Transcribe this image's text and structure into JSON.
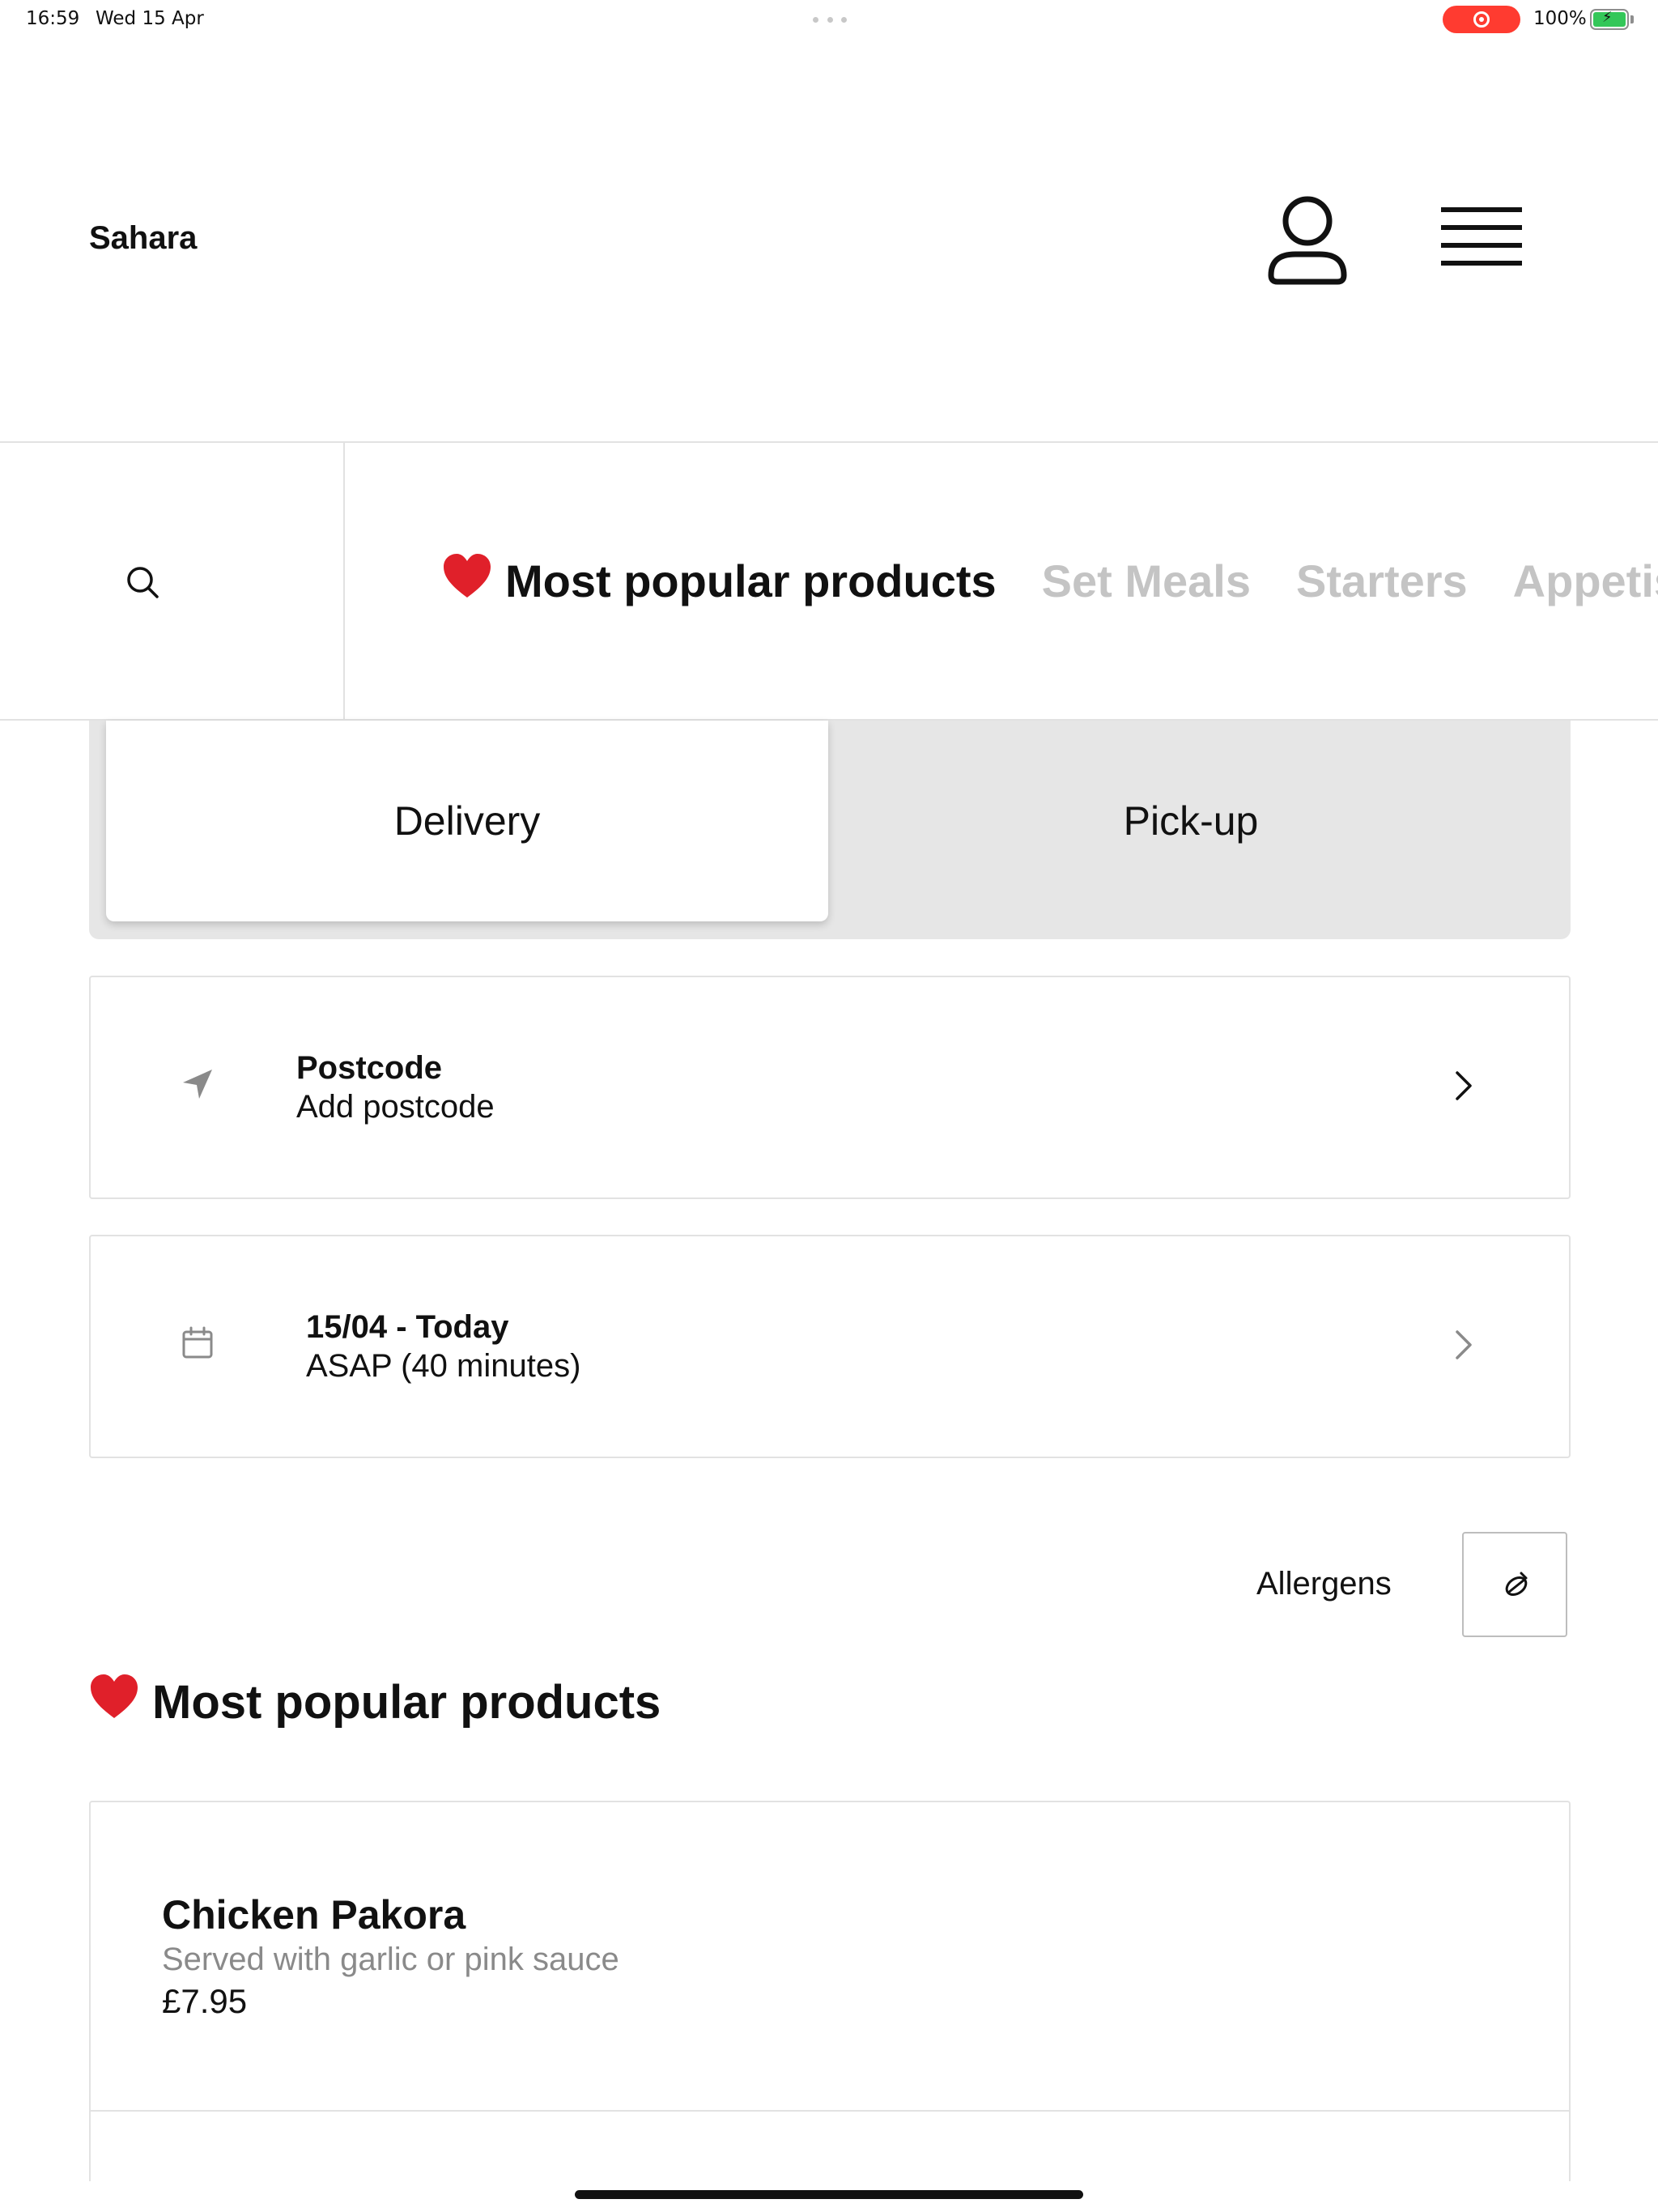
{
  "status_bar": {
    "time": "16:59",
    "date": "Wed 15 Apr",
    "battery": "100%"
  },
  "header": {
    "brand": "Sahara",
    "account_icon": "person-icon",
    "menu_icon": "hamburger-menu-icon"
  },
  "categories": {
    "search_icon": "search-icon",
    "tabs": [
      {
        "label": "Most popular products",
        "emoji": "❤️",
        "active": true
      },
      {
        "label": "Set Meals",
        "active": false
      },
      {
        "label": "Starters",
        "active": false
      },
      {
        "label": "Appetisers",
        "active": false
      }
    ]
  },
  "order_mode": {
    "delivery": "Delivery",
    "pickup": "Pick-up",
    "selected": "delivery"
  },
  "postcode_card": {
    "title": "Postcode",
    "value": "Add postcode",
    "icon": "location-arrow-icon"
  },
  "time_card": {
    "title": "15/04 - Today",
    "value": "ASAP (40 minutes)",
    "icon": "calendar-icon"
  },
  "allergens": {
    "label": "Allergens",
    "icon": "allergen-icon"
  },
  "section": {
    "emoji": "❤️",
    "title": "Most popular products"
  },
  "products": [
    {
      "name": "Chicken Pakora",
      "description": "Served with garlic or pink sauce",
      "price": "£7.95"
    }
  ],
  "colors": {
    "text": "#111111",
    "muted": "#8a8a8a",
    "inactive_tab": "#c4c4c4",
    "border": "#e2e2e2",
    "toggle_bg": "#e6e6e6",
    "heart": "#e0202a"
  }
}
